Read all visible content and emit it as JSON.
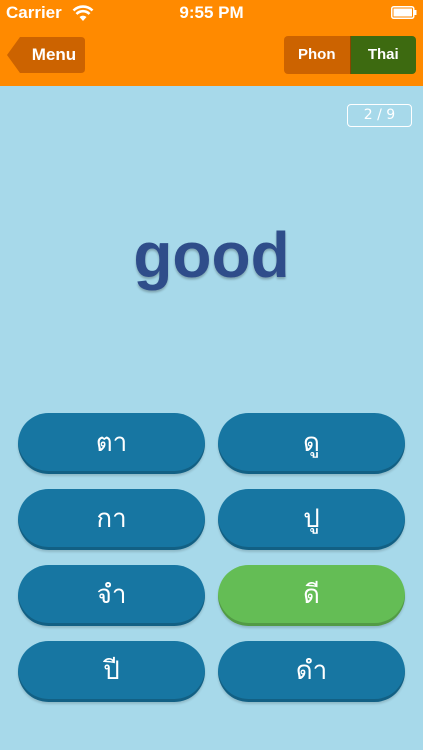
{
  "status_bar": {
    "carrier": "Carrier",
    "time": "9:55 PM",
    "icons": [
      "wifi-icon",
      "battery-icon"
    ]
  },
  "nav": {
    "menu_label": "Menu",
    "segments": [
      "Phon",
      "Thai"
    ],
    "selected_segment": "Thai"
  },
  "quiz": {
    "counter": "2 / 9",
    "word": "good",
    "answers": [
      "ตา",
      "ดู",
      "กา",
      "ปู",
      "จำ",
      "ดี",
      "ปี",
      "ดำ"
    ],
    "correct_answer": "ดี"
  },
  "colors": {
    "nav_bg": "#ff8a00",
    "background": "#a7d9ea",
    "word": "#2f4d8a",
    "answer_button": "#1776a2",
    "answer_correct": "#64bd55",
    "segment_phon": "#cc6300",
    "segment_thai": "#3d6a10"
  }
}
